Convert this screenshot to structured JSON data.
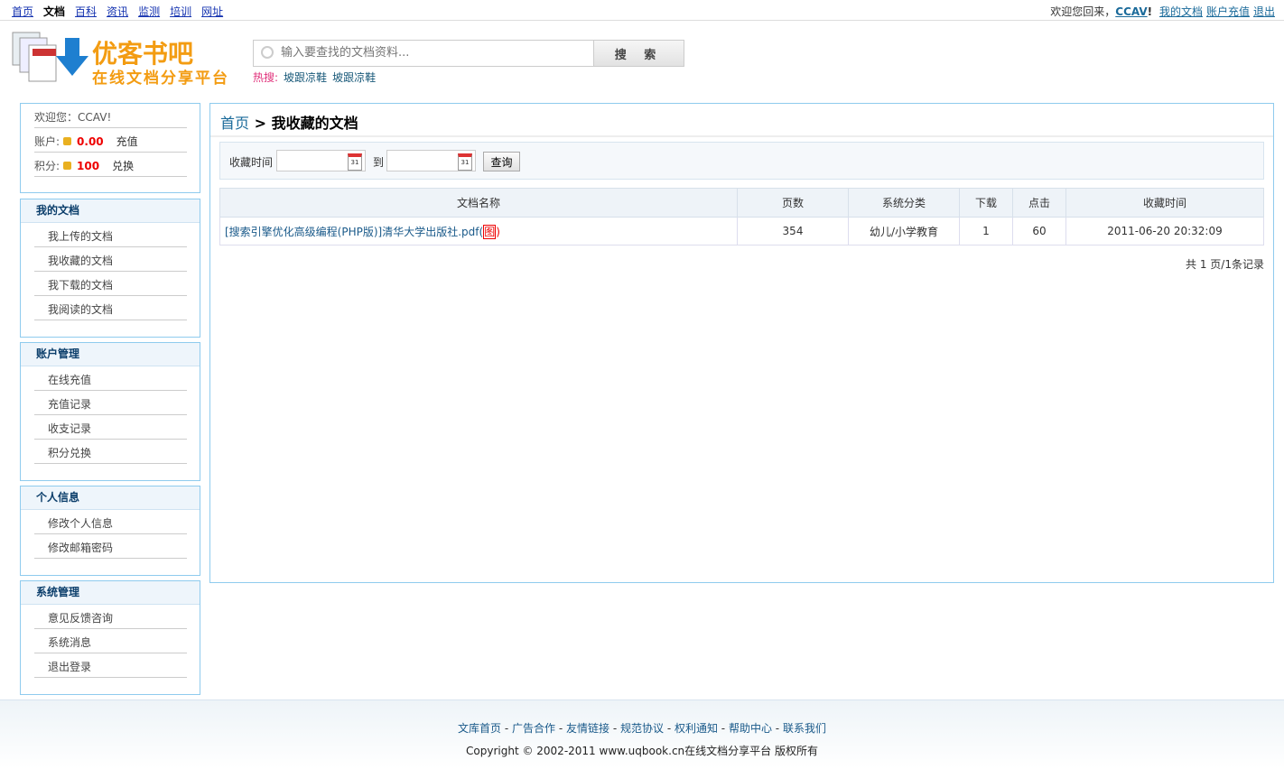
{
  "topnav": [
    "首页",
    "文档",
    "百科",
    "资讯",
    "监测",
    "培训",
    "网址"
  ],
  "topright": {
    "welcome": "欢迎您回来，",
    "user": "CCAV",
    "links": [
      "我的文档",
      "账户充值",
      "退出"
    ]
  },
  "logo": {
    "title": "优客书吧",
    "subtitle": "在线文档分享平台"
  },
  "search": {
    "placeholder": "输入要查找的文档资料...",
    "button": "搜 索",
    "hot_label": "热搜:",
    "hot": [
      "坡跟凉鞋",
      "坡跟凉鞋"
    ]
  },
  "userinfo": {
    "welcome": "欢迎您：",
    "user": "CCAV",
    "account_label": "账户:",
    "balance": "0.00",
    "recharge": "充值",
    "points_label": "积分:",
    "points": "100",
    "exchange": "兑换"
  },
  "sidebar": [
    {
      "title": "我的文档",
      "items": [
        "我上传的文档",
        "我收藏的文档",
        "我下载的文档",
        "我阅读的文档"
      ]
    },
    {
      "title": "账户管理",
      "items": [
        "在线充值",
        "充值记录",
        "收支记录",
        "积分兑换"
      ]
    },
    {
      "title": "个人信息",
      "items": [
        "修改个人信息",
        "修改邮箱密码"
      ]
    },
    {
      "title": "系统管理",
      "items": [
        "意见反馈咨询",
        "系统消息",
        "退出登录"
      ]
    }
  ],
  "main": {
    "home": "首页",
    "sep": " > ",
    "title": "我收藏的文档",
    "filter_label": "收藏时间",
    "to": "到",
    "query": "查询",
    "cal": "31",
    "columns": [
      "文档名称",
      "页数",
      "系统分类",
      "下载",
      "点击",
      "收藏时间"
    ],
    "rows": [
      {
        "name": "[搜索引擎优化高级编程(PHP版)]清华大学出版社.pdf",
        "tag": "图",
        "pages": "354",
        "category": "幼儿/小学教育",
        "downloads": "1",
        "clicks": "60",
        "time": "2011-06-20 20:32:09"
      }
    ],
    "pagination": "共 1 页/1条记录"
  },
  "footer": {
    "links": [
      "文库首页",
      "广告合作",
      "友情链接",
      "规范协议",
      "权利通知",
      "帮助中心",
      "联系我们"
    ],
    "copyright": "Copyright © 2002-2011 www.uqbook.cn在线文档分享平台 版权所有"
  }
}
